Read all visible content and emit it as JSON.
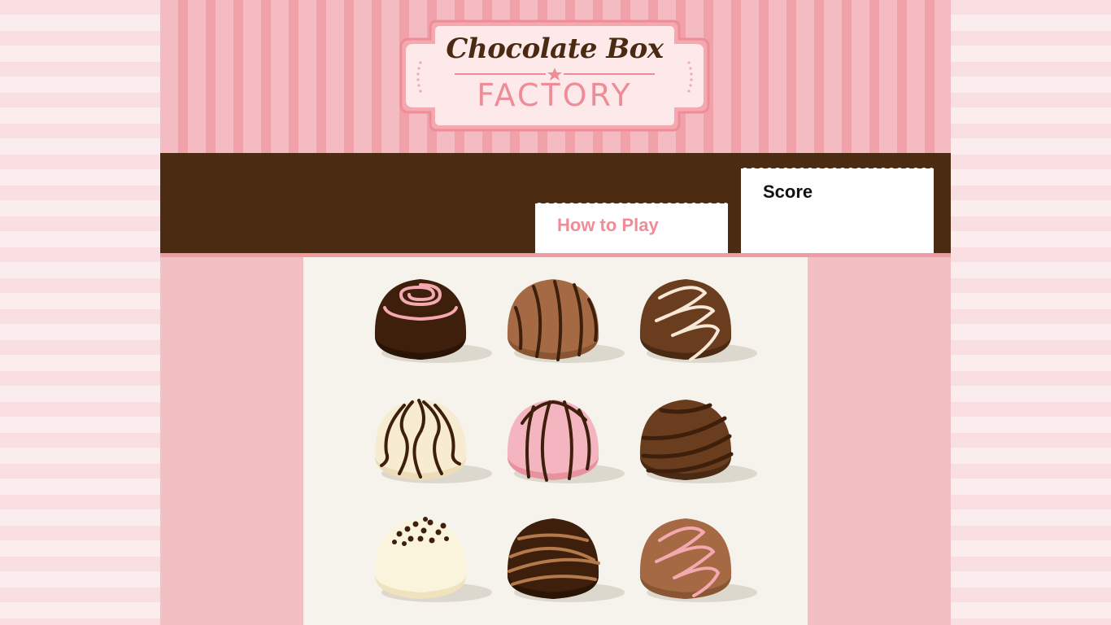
{
  "header": {
    "logo_script": "Chocolate Box",
    "logo_factory": "FACTORY"
  },
  "nav": {
    "how_to_play": "How to Play",
    "score_label": "Score"
  },
  "colors": {
    "pink_accent": "#ee8d97",
    "dark_chocolate": "#4b2b12",
    "board_bg": "#f5f3ec"
  },
  "board": {
    "chocolates": [
      {
        "id": "choc-1",
        "base": "dark",
        "topping": "pink-swirl"
      },
      {
        "id": "choc-2",
        "base": "milk",
        "topping": "dark-stripes"
      },
      {
        "id": "choc-3",
        "base": "dark",
        "topping": "white-zigzag"
      },
      {
        "id": "choc-4",
        "base": "white",
        "topping": "dark-waves"
      },
      {
        "id": "choc-5",
        "base": "pink",
        "topping": "dark-stripes"
      },
      {
        "id": "choc-6",
        "base": "dark",
        "topping": "dark-diagonals"
      },
      {
        "id": "choc-7",
        "base": "white",
        "topping": "dark-sprinkles"
      },
      {
        "id": "choc-8",
        "base": "dark",
        "topping": "milk-stripes"
      },
      {
        "id": "choc-9",
        "base": "milk",
        "topping": "pink-zigzag"
      }
    ]
  }
}
